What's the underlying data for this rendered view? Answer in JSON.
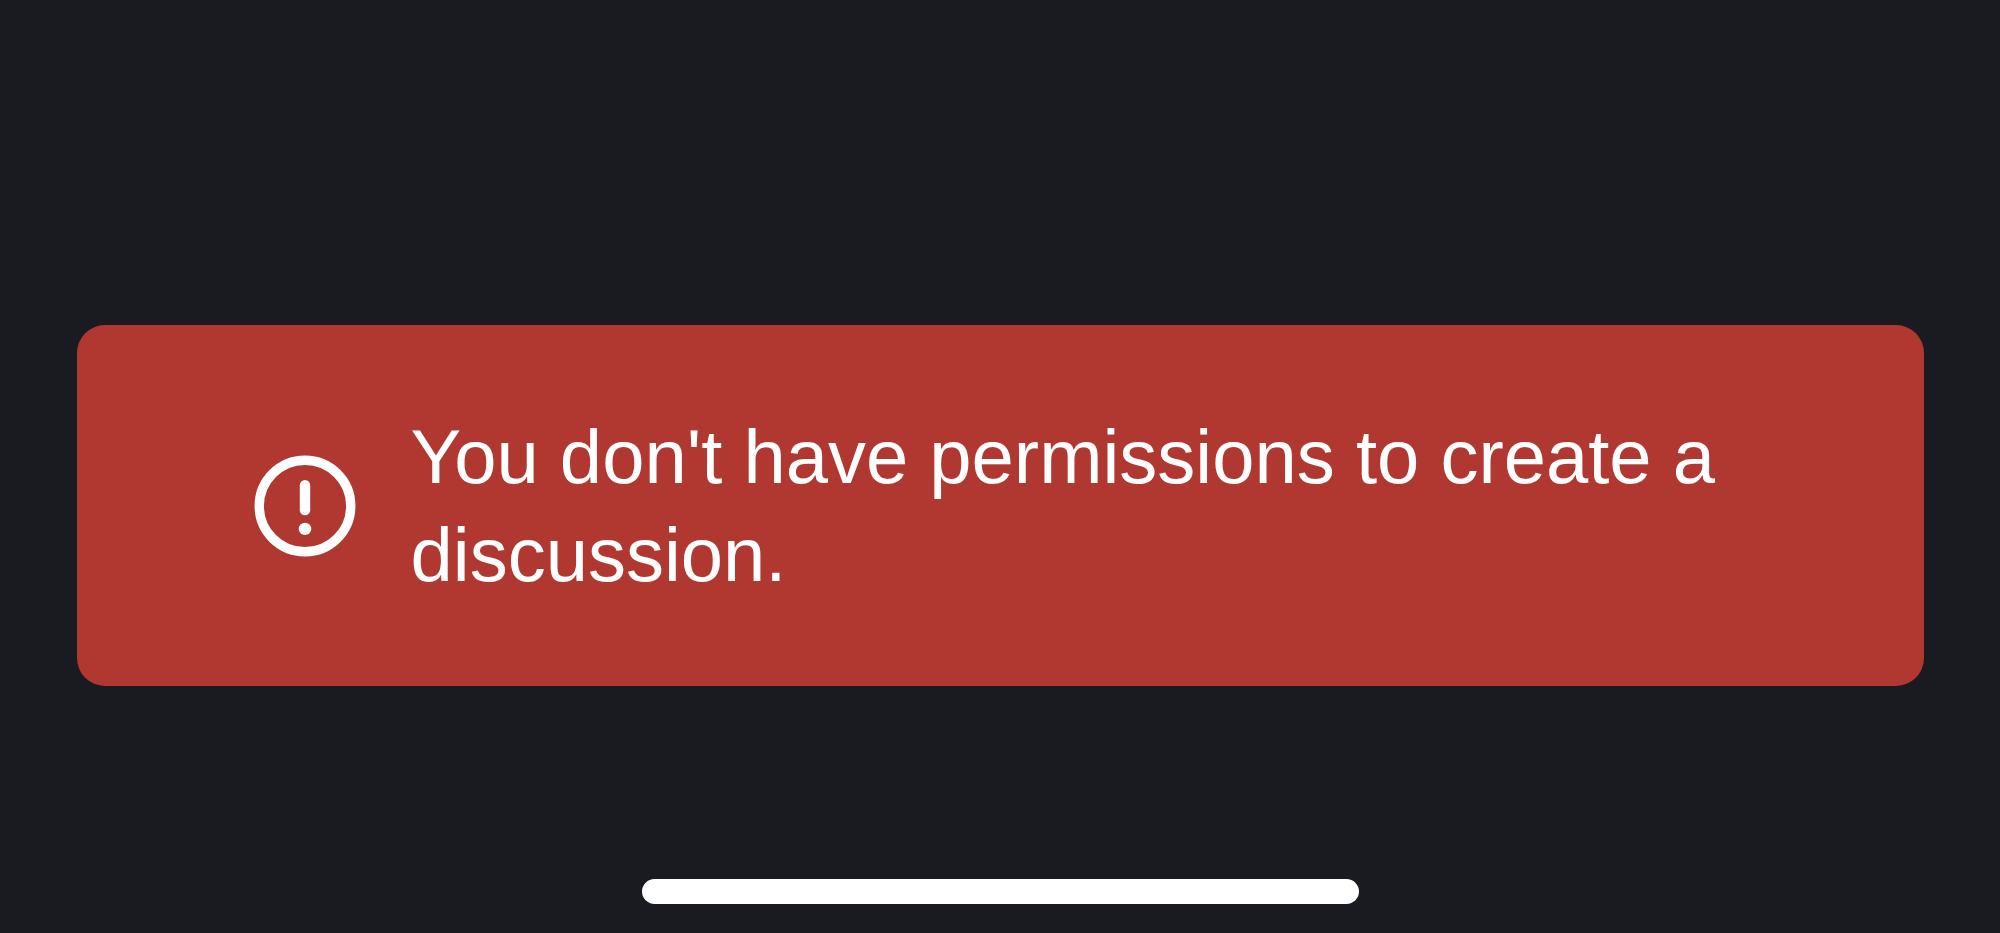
{
  "banner": {
    "kind": "error",
    "message": "You don't have permissions to create a discussion."
  }
}
